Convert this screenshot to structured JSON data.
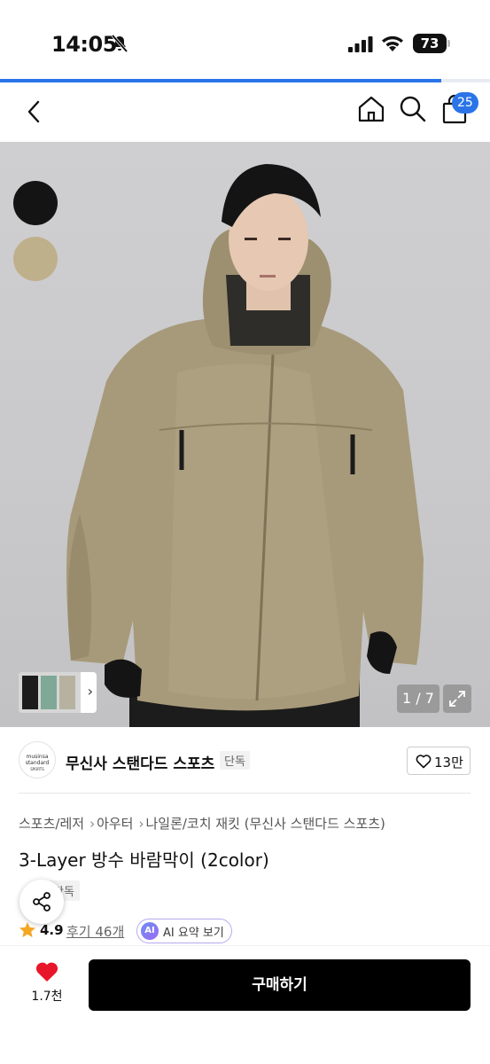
{
  "status_bar": {
    "time": "14:05",
    "battery": "73"
  },
  "nav": {
    "cart_count": "25"
  },
  "progress": {
    "fraction": 0.9
  },
  "gallery": {
    "counter": "1 / 7",
    "swatches": [
      {
        "name": "black",
        "color": "#141414"
      },
      {
        "name": "beige",
        "color": "#bfb08c"
      }
    ]
  },
  "brand": {
    "logo_text_line1": "musinsa",
    "logo_text_line2": "standard",
    "logo_text_line3": "SPORTS",
    "name": "무신사 스탠다드 스포츠",
    "tag": "단독",
    "like_count": "13만"
  },
  "product": {
    "breadcrumb": [
      "스포츠/레저",
      "아우터",
      "나일론/코치 재킷 (무신사 스탠다드 스포츠)"
    ],
    "title": "3-Layer 방수 바람막이 (2color)",
    "exclusive_tag": "단독",
    "rating": "4.9",
    "review_link": "후기 46개",
    "ai_summary": "AI 요약 보기",
    "ai_chip": "AI"
  },
  "bottom_bar": {
    "wish_count": "1.7천",
    "buy_label": "구매하기"
  },
  "colors": {
    "accent": "#2a74e8",
    "buy_button": "#000000",
    "heart": "#e8162a"
  }
}
